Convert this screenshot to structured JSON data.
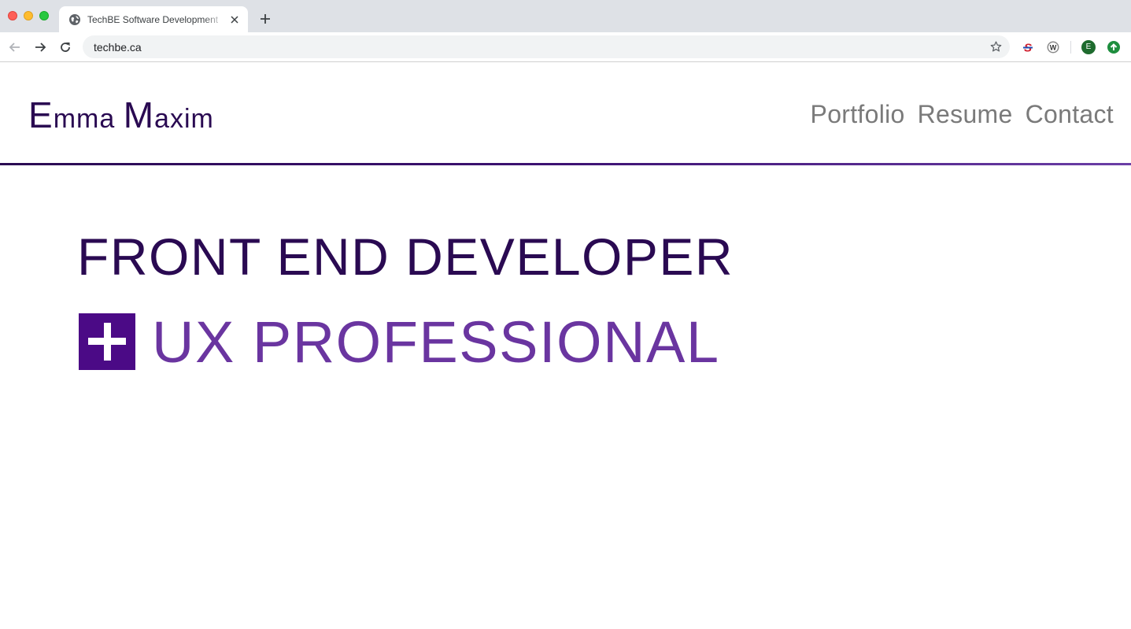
{
  "browser": {
    "tab": {
      "title": "TechBE Software Development",
      "favicon": "globe-icon"
    },
    "address_bar": {
      "url": "techbe.ca"
    },
    "extensions": [
      {
        "name": "s-extension-icon"
      },
      {
        "name": "w-extension-icon"
      }
    ],
    "profile": {
      "initial": "E"
    }
  },
  "site": {
    "name_parts": [
      {
        "cap": "E",
        "rest": "mma"
      },
      {
        "cap": "M",
        "rest": "axim"
      }
    ],
    "nav": {
      "portfolio": "Portfolio",
      "resume": "Resume",
      "contact": "Contact"
    },
    "hero": {
      "line1": "FRONT END DEVELOPER",
      "line2": "UX PROFESSIONAL"
    }
  },
  "colors": {
    "brand_dark": "#2a0a52",
    "brand_purple": "#4b0a86",
    "accent_purple": "#6a35a0",
    "nav_gray": "#7a7a7a"
  }
}
